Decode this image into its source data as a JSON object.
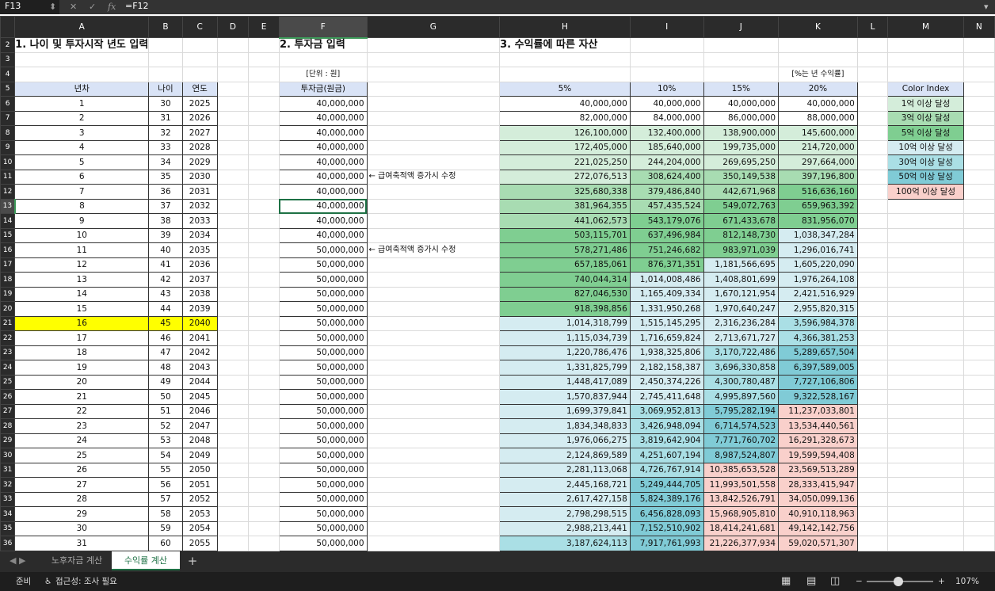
{
  "name_box": "F13",
  "formula": "=F12",
  "columns": [
    "A",
    "B",
    "C",
    "D",
    "E",
    "F",
    "G",
    "H",
    "I",
    "J",
    "K",
    "L",
    "M",
    "N"
  ],
  "titles": {
    "t1": "1. 나이 및 투자시작 년도 입력",
    "t2": "2. 투자금 입력",
    "t3": "3. 수익률에 따른 자산"
  },
  "unit_label": "[단위 : 원]",
  "rate_label": "[%는 년 수익률]",
  "headers": {
    "year": "년차",
    "age": "나이",
    "yr": "연도",
    "invest": "투자금(원금)",
    "r5": "5%",
    "r10": "10%",
    "r15": "15%",
    "r20": "20%",
    "legend": "Color Index"
  },
  "note": "← 급여축적액 증가시 수정",
  "legend": [
    "1억 이상 달성",
    "3억 이상 달성",
    "5억 이상 달성",
    "10억 이상 달성",
    "30억 이상 달성",
    "50억 이상 달성",
    "100억 이상 달성"
  ],
  "rows": [
    [
      "1",
      "30",
      "2025",
      "40,000,000",
      "40,000,000",
      "40,000,000",
      "40,000,000",
      "40,000,000"
    ],
    [
      "2",
      "31",
      "2026",
      "40,000,000",
      "82,000,000",
      "84,000,000",
      "86,000,000",
      "88,000,000"
    ],
    [
      "3",
      "32",
      "2027",
      "40,000,000",
      "126,100,000",
      "132,400,000",
      "138,900,000",
      "145,600,000"
    ],
    [
      "4",
      "33",
      "2028",
      "40,000,000",
      "172,405,000",
      "185,640,000",
      "199,735,000",
      "214,720,000"
    ],
    [
      "5",
      "34",
      "2029",
      "40,000,000",
      "221,025,250",
      "244,204,000",
      "269,695,250",
      "297,664,000"
    ],
    [
      "6",
      "35",
      "2030",
      "40,000,000",
      "272,076,513",
      "308,624,400",
      "350,149,538",
      "397,196,800"
    ],
    [
      "7",
      "36",
      "2031",
      "40,000,000",
      "325,680,338",
      "379,486,840",
      "442,671,968",
      "516,636,160"
    ],
    [
      "8",
      "37",
      "2032",
      "40,000,000",
      "381,964,355",
      "457,435,524",
      "549,072,763",
      "659,963,392"
    ],
    [
      "9",
      "38",
      "2033",
      "40,000,000",
      "441,062,573",
      "543,179,076",
      "671,433,678",
      "831,956,070"
    ],
    [
      "10",
      "39",
      "2034",
      "40,000,000",
      "503,115,701",
      "637,496,984",
      "812,148,730",
      "1,038,347,284"
    ],
    [
      "11",
      "40",
      "2035",
      "50,000,000",
      "578,271,486",
      "751,246,682",
      "983,971,039",
      "1,296,016,741"
    ],
    [
      "12",
      "41",
      "2036",
      "50,000,000",
      "657,185,061",
      "876,371,351",
      "1,181,566,695",
      "1,605,220,090"
    ],
    [
      "13",
      "42",
      "2037",
      "50,000,000",
      "740,044,314",
      "1,014,008,486",
      "1,408,801,699",
      "1,976,264,108"
    ],
    [
      "14",
      "43",
      "2038",
      "50,000,000",
      "827,046,530",
      "1,165,409,334",
      "1,670,121,954",
      "2,421,516,929"
    ],
    [
      "15",
      "44",
      "2039",
      "50,000,000",
      "918,398,856",
      "1,331,950,268",
      "1,970,640,247",
      "2,955,820,315"
    ],
    [
      "16",
      "45",
      "2040",
      "50,000,000",
      "1,014,318,799",
      "1,515,145,295",
      "2,316,236,284",
      "3,596,984,378"
    ],
    [
      "17",
      "46",
      "2041",
      "50,000,000",
      "1,115,034,739",
      "1,716,659,824",
      "2,713,671,727",
      "4,366,381,253"
    ],
    [
      "18",
      "47",
      "2042",
      "50,000,000",
      "1,220,786,476",
      "1,938,325,806",
      "3,170,722,486",
      "5,289,657,504"
    ],
    [
      "19",
      "48",
      "2043",
      "50,000,000",
      "1,331,825,799",
      "2,182,158,387",
      "3,696,330,858",
      "6,397,589,005"
    ],
    [
      "20",
      "49",
      "2044",
      "50,000,000",
      "1,448,417,089",
      "2,450,374,226",
      "4,300,780,487",
      "7,727,106,806"
    ],
    [
      "21",
      "50",
      "2045",
      "50,000,000",
      "1,570,837,944",
      "2,745,411,648",
      "4,995,897,560",
      "9,322,528,167"
    ],
    [
      "22",
      "51",
      "2046",
      "50,000,000",
      "1,699,379,841",
      "3,069,952,813",
      "5,795,282,194",
      "11,237,033,801"
    ],
    [
      "23",
      "52",
      "2047",
      "50,000,000",
      "1,834,348,833",
      "3,426,948,094",
      "6,714,574,523",
      "13,534,440,561"
    ],
    [
      "24",
      "53",
      "2048",
      "50,000,000",
      "1,976,066,275",
      "3,819,642,904",
      "7,771,760,702",
      "16,291,328,673"
    ],
    [
      "25",
      "54",
      "2049",
      "50,000,000",
      "2,124,869,589",
      "4,251,607,194",
      "8,987,524,807",
      "19,599,594,408"
    ],
    [
      "26",
      "55",
      "2050",
      "50,000,000",
      "2,281,113,068",
      "4,726,767,914",
      "10,385,653,528",
      "23,569,513,289"
    ],
    [
      "27",
      "56",
      "2051",
      "50,000,000",
      "2,445,168,721",
      "5,249,444,705",
      "11,993,501,558",
      "28,333,415,947"
    ],
    [
      "28",
      "57",
      "2052",
      "50,000,000",
      "2,617,427,158",
      "5,824,389,176",
      "13,842,526,791",
      "34,050,099,136"
    ],
    [
      "29",
      "58",
      "2053",
      "50,000,000",
      "2,798,298,515",
      "6,456,828,093",
      "15,968,905,810",
      "40,910,118,963"
    ],
    [
      "30",
      "59",
      "2054",
      "50,000,000",
      "2,988,213,441",
      "7,152,510,902",
      "18,414,241,681",
      "49,142,142,756"
    ],
    [
      "31",
      "60",
      "2055",
      "50,000,000",
      "3,187,624,113",
      "7,917,761,993",
      "21,226,377,934",
      "59,020,571,307"
    ]
  ],
  "highlight_row": 16,
  "thresholds": [
    100000000,
    300000000,
    500000000,
    1000000000,
    3000000000,
    5000000000,
    10000000000
  ],
  "colors": {
    "none": "#ffffff",
    "c1": "#d4edda",
    "c2": "#a8dcb2",
    "c3": "#7fce91",
    "c4": "#d5ecf1",
    "c5": "#aadfe5",
    "c6": "#80cbd6",
    "c7": "#f9d0cb",
    "highlight": "#ffff00",
    "select": "#1e7145"
  },
  "sheets": [
    "노후자금 계산",
    "수익률 계산"
  ],
  "active_sheet": 1,
  "add_sheet": "+",
  "status": {
    "ready": "준비",
    "access": "접근성: 조사 필요",
    "zoom": "107%"
  }
}
